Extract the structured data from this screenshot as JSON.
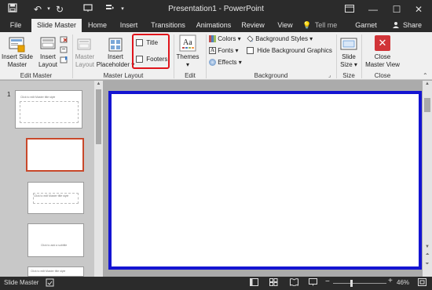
{
  "titlebar": {
    "title": "Presentation1 - PowerPoint",
    "icons": [
      "save-icon",
      "undo-icon",
      "redo-icon",
      "customize-qat-icon",
      "slideshow-icon"
    ]
  },
  "tabs": {
    "file": "File",
    "slide_master": "Slide Master",
    "home": "Home",
    "insert": "Insert",
    "transitions": "Transitions",
    "animations": "Animations",
    "review": "Review",
    "view": "View",
    "tell_me": "Tell me",
    "user": "Garnet Indezi...",
    "share": "Share"
  },
  "ribbon": {
    "insert_slide_master": [
      "Insert Slide",
      "Master"
    ],
    "insert_layout": [
      "Insert",
      "Layout"
    ],
    "master_layout": [
      "Master",
      "Layout"
    ],
    "insert_placeholder": [
      "Insert",
      "Placeholder"
    ],
    "title_checkbox": "Title",
    "footers_checkbox": "Footers",
    "themes": "Themes",
    "colors": "Colors",
    "fonts": "Fonts",
    "effects": "Effects",
    "background_styles": "Background Styles",
    "hide_background_graphics": "Hide Background Graphics",
    "slide_size": [
      "Slide",
      "Size"
    ],
    "close_master_view": [
      "Close",
      "Master View"
    ],
    "groups": {
      "edit_master": "Edit Master",
      "master_layout": "Master Layout",
      "edit_theme": "Edit Theme",
      "background": "Background",
      "size": "Size",
      "close": "Close"
    }
  },
  "thumbnails": {
    "slide_number": "1",
    "master_title": "Click to edit Master title style",
    "layout_title": "Click to edit Master title style",
    "add_subtitle": "Click to add a subtitle",
    "last_title": "Click to edit Master title style"
  },
  "statusbar": {
    "view_name": "Slide Master",
    "zoom": "46%"
  },
  "colors": {
    "chrome_dark": "#2b2b2b",
    "ribbon_bg": "#f0f0f0",
    "slide_border": "#1414d2",
    "highlight_red": "#e0141b",
    "selected_thumb": "#c8482a",
    "close_red": "#d13438"
  }
}
